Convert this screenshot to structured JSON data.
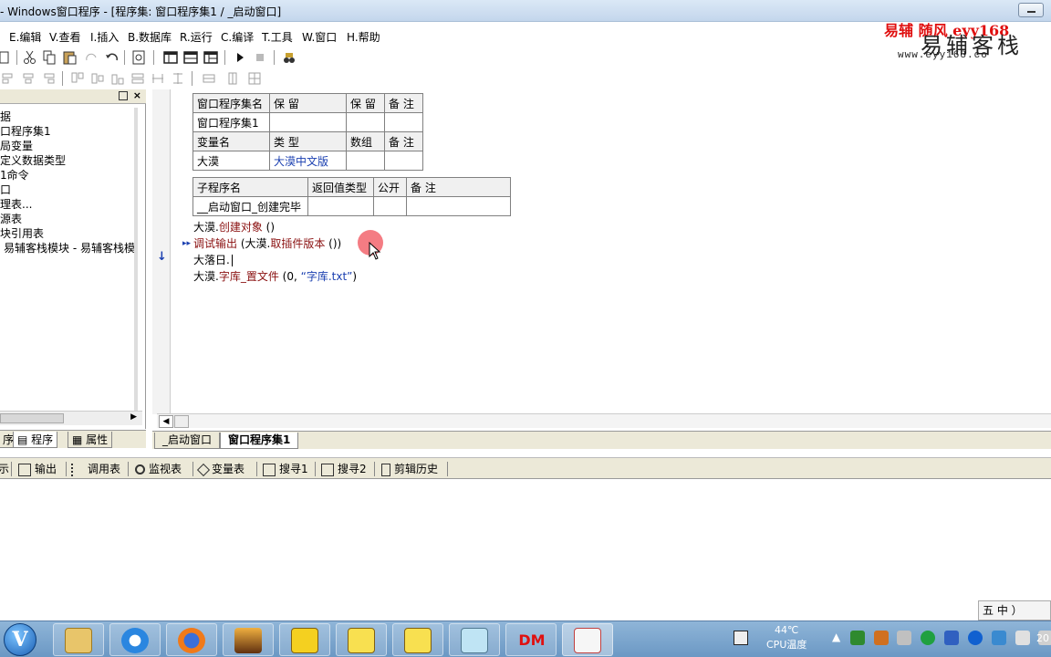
{
  "window": {
    "title": "- Windows窗口程序 - [程序集: 窗口程序集1 / _启动窗口]"
  },
  "brand": {
    "line1": "易辅  随风  eyy168",
    "line2": "易辅客栈",
    "url": "www.eyy168.co"
  },
  "menu": [
    "E.编辑",
    "V.查看",
    "I.插入",
    "B.数据库",
    "R.运行",
    "C.编译",
    "T.工具",
    "W.窗口",
    "H.帮助"
  ],
  "left_tree": {
    "items": [
      "据",
      "口程序集1",
      "局变量",
      "定义数据类型",
      "1命令",
      "口",
      "理表...",
      "源表",
      "块引用表",
      "易辅客栈模块 - 易辅客栈模"
    ]
  },
  "left_tabs": [
    "序",
    "程序",
    "属性"
  ],
  "assembly_table": {
    "headers": [
      "窗口程序集名",
      "保 留",
      "保 留",
      "备 注"
    ],
    "row": [
      "窗口程序集1",
      "",
      "",
      ""
    ],
    "var_headers": [
      "变量名",
      "类 型",
      "数组",
      "备 注"
    ],
    "var_row": [
      "大漠",
      "大漠中文版",
      "",
      ""
    ]
  },
  "sub_table": {
    "headers": [
      "子程序名",
      "返回值类型",
      "公开",
      "备 注"
    ],
    "row": [
      "__启动窗口_创建完毕",
      "",
      "",
      ""
    ]
  },
  "code": {
    "line1_obj": "大漠.",
    "line1_call": "创建对象",
    "line1_args": " ()",
    "line2_call": "调试输出",
    "line2_args": " (大漠.",
    "line2_inner": "取插件版本",
    "line2_end": " ())",
    "line3": "大落日.",
    "line4_obj": "大漠.",
    "line4_call": "字库_置文件",
    "line4_args": " (0, ",
    "line4_str": "“字库.txt”",
    "line4_end": ")"
  },
  "doc_tabs": [
    "_启动窗口",
    "窗口程序集1"
  ],
  "bottom_tabs": [
    "示",
    "输出",
    "调用表",
    "监视表",
    "变量表",
    "搜寻1",
    "搜寻2",
    "剪辑历史"
  ],
  "ime": "五 中 ）",
  "taskbar": {
    "dm_label": "DM",
    "temp": "44℃",
    "temp_label": "CPU温度",
    "clock": "20"
  }
}
